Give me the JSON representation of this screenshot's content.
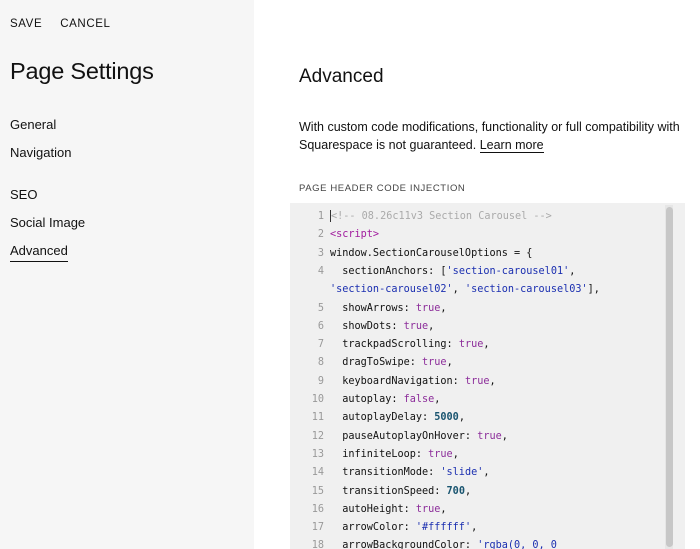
{
  "toolbar": {
    "save_label": "SAVE",
    "cancel_label": "CANCEL"
  },
  "sidebar": {
    "title": "Page Settings",
    "items": [
      {
        "label": "General"
      },
      {
        "label": "Navigation"
      },
      {
        "label": "SEO"
      },
      {
        "label": "Social Image"
      },
      {
        "label": "Advanced"
      }
    ]
  },
  "main": {
    "title": "Advanced",
    "description": "With custom code modifications, functionality or full compatibility with Squarespace is not guaranteed.",
    "learn_more": "Learn more",
    "section_label": "PAGE HEADER CODE INJECTION"
  },
  "editor": {
    "lines": [
      {
        "n": "1",
        "tokens": [
          [
            "comment",
            "<!-- 08.26c11v3 Section Carousel -->"
          ]
        ]
      },
      {
        "n": "2",
        "tokens": [
          [
            "tag",
            "<script>"
          ]
        ]
      },
      {
        "n": "3",
        "tokens": [
          [
            "code",
            "window.SectionCarouselOptions = {"
          ]
        ]
      },
      {
        "n": "4",
        "tokens": [
          [
            "code",
            "  sectionAnchors: ["
          ],
          [
            "str",
            "'section-carousel01'"
          ],
          [
            "code",
            ","
          ]
        ]
      },
      {
        "n": "",
        "tokens": [
          [
            "str",
            "'section-carousel02'"
          ],
          [
            "code",
            ", "
          ],
          [
            "str",
            "'section-carousel03'"
          ],
          [
            "code",
            "],"
          ]
        ]
      },
      {
        "n": "5",
        "tokens": [
          [
            "code",
            "  showArrows: "
          ],
          [
            "kw",
            "true"
          ],
          [
            "code",
            ","
          ]
        ]
      },
      {
        "n": "6",
        "tokens": [
          [
            "code",
            "  showDots: "
          ],
          [
            "kw",
            "true"
          ],
          [
            "code",
            ","
          ]
        ]
      },
      {
        "n": "7",
        "tokens": [
          [
            "code",
            "  trackpadScrolling: "
          ],
          [
            "kw",
            "true"
          ],
          [
            "code",
            ","
          ]
        ]
      },
      {
        "n": "8",
        "tokens": [
          [
            "code",
            "  dragToSwipe: "
          ],
          [
            "kw",
            "true"
          ],
          [
            "code",
            ","
          ]
        ]
      },
      {
        "n": "9",
        "tokens": [
          [
            "code",
            "  keyboardNavigation: "
          ],
          [
            "kw",
            "true"
          ],
          [
            "code",
            ","
          ]
        ]
      },
      {
        "n": "10",
        "tokens": [
          [
            "code",
            "  autoplay: "
          ],
          [
            "kw",
            "false"
          ],
          [
            "code",
            ","
          ]
        ]
      },
      {
        "n": "11",
        "tokens": [
          [
            "code",
            "  autoplayDelay: "
          ],
          [
            "num",
            "5000"
          ],
          [
            "code",
            ","
          ]
        ]
      },
      {
        "n": "12",
        "tokens": [
          [
            "code",
            "  pauseAutoplayOnHover: "
          ],
          [
            "kw",
            "true"
          ],
          [
            "code",
            ","
          ]
        ]
      },
      {
        "n": "13",
        "tokens": [
          [
            "code",
            "  infiniteLoop: "
          ],
          [
            "kw",
            "true"
          ],
          [
            "code",
            ","
          ]
        ]
      },
      {
        "n": "14",
        "tokens": [
          [
            "code",
            "  transitionMode: "
          ],
          [
            "str",
            "'slide'"
          ],
          [
            "code",
            ","
          ]
        ]
      },
      {
        "n": "15",
        "tokens": [
          [
            "code",
            "  transitionSpeed: "
          ],
          [
            "num",
            "700"
          ],
          [
            "code",
            ","
          ]
        ]
      },
      {
        "n": "16",
        "tokens": [
          [
            "code",
            "  autoHeight: "
          ],
          [
            "kw",
            "true"
          ],
          [
            "code",
            ","
          ]
        ]
      },
      {
        "n": "17",
        "tokens": [
          [
            "code",
            "  arrowColor: "
          ],
          [
            "str",
            "'#ffffff'"
          ],
          [
            "code",
            ","
          ]
        ]
      },
      {
        "n": "18",
        "tokens": [
          [
            "code",
            "  arrowBackgroundColor: "
          ],
          [
            "str",
            "'rgba(0, 0, 0"
          ]
        ]
      }
    ]
  }
}
